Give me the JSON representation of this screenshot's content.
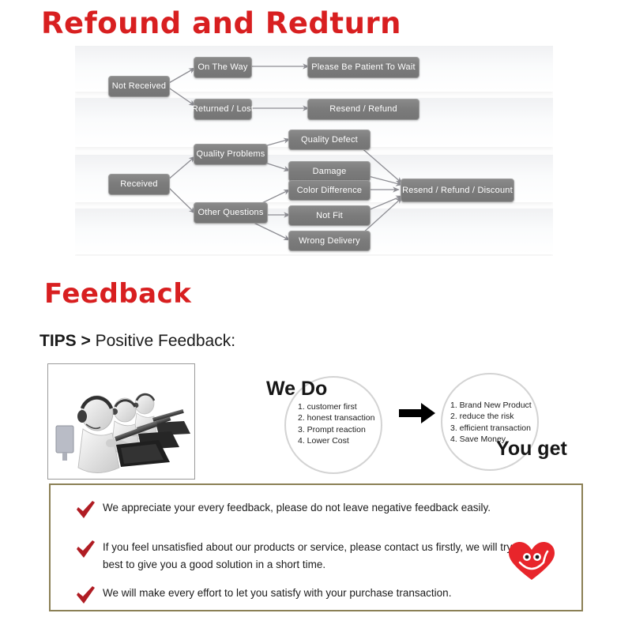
{
  "sections": {
    "refund_title": "Refound and Redturn",
    "feedback_title": "Feedback"
  },
  "flowchart": {
    "nodes": {
      "not_received": "Not Received",
      "on_the_way": "On The Way",
      "please_wait": "Please Be Patient To Wait",
      "returned_lost": "Returned / Lost",
      "resend_refund": "Resend / Refund",
      "received": "Received",
      "quality_problems": "Quality Problems",
      "other_questions": "Other Questions",
      "quality_defect": "Quality Defect",
      "damage": "Damage",
      "color_difference": "Color Difference",
      "not_fit": "Not Fit",
      "wrong_delivery": "Wrong Delivery",
      "resend_refund_discount": "Resend / Refund / Discount"
    }
  },
  "tips": {
    "prefix": "TIPS >",
    "text": "Positive Feedback:"
  },
  "we_do": {
    "label": "We Do",
    "items": [
      "1. customer first",
      "2. honest transaction",
      "3. Prompt reaction",
      "4. Lower Cost"
    ]
  },
  "you_get": {
    "label": "You get",
    "items": [
      "1. Brand New Product",
      "2. reduce the risk",
      "3. efficient transaction",
      "4. Save Money"
    ]
  },
  "notes": [
    "We appreciate your every feedback, please do not leave negative feedback easily.",
    "If you feel unsatisfied about our products or service, please contact us firstly, we will try best to give you a good solution in a short time.",
    "We will make every effort to let you satisfy with your purchase transaction."
  ],
  "colors": {
    "title_red": "#d81f20",
    "node_gray": "#7b7b7b",
    "note_border": "#8b8055",
    "check_red": "#b01c23",
    "heart_red": "#e8252b"
  }
}
